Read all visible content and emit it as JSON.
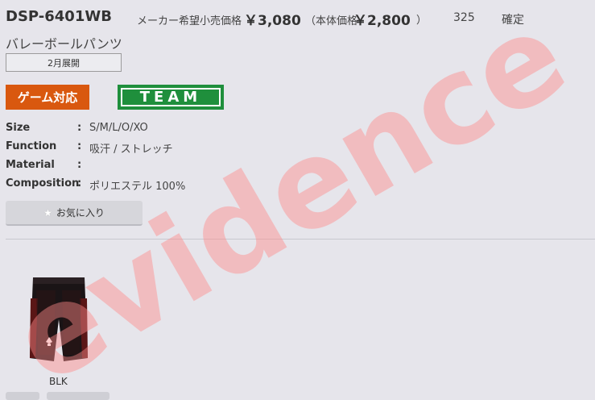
{
  "product": {
    "code": "DSP-6401WB",
    "maker_price_label": "メーカー希望小売価格",
    "maker_price": "￥3,080",
    "base_price_label": "（本体価格",
    "base_price": "￥2,800",
    "paren_close": "）",
    "number": "325",
    "status": "確定",
    "name": "バレーボールパンツ",
    "release": "2月展開"
  },
  "badges": {
    "game": "ゲーム対応",
    "team": "TEAM"
  },
  "specs": [
    {
      "label": "Size",
      "colon": ":",
      "value": "S/M/L/O/XO"
    },
    {
      "label": "Function",
      "colon": ":",
      "value": "吸汗 / ストレッチ"
    },
    {
      "label": "Material",
      "colon": ":",
      "value": ""
    },
    {
      "label": "Composition",
      "colon": ":",
      "value": "ポリエステル 100%"
    }
  ],
  "favorite": {
    "label": "お気に入り",
    "icon": "star-icon"
  },
  "variant": {
    "color_label": "BLK"
  },
  "watermark": "evidence",
  "colors": {
    "game_badge": "#d9580f",
    "team_badge": "#1f8f3c",
    "watermark": "#ff8a8a",
    "background": "#e6e5eb"
  }
}
